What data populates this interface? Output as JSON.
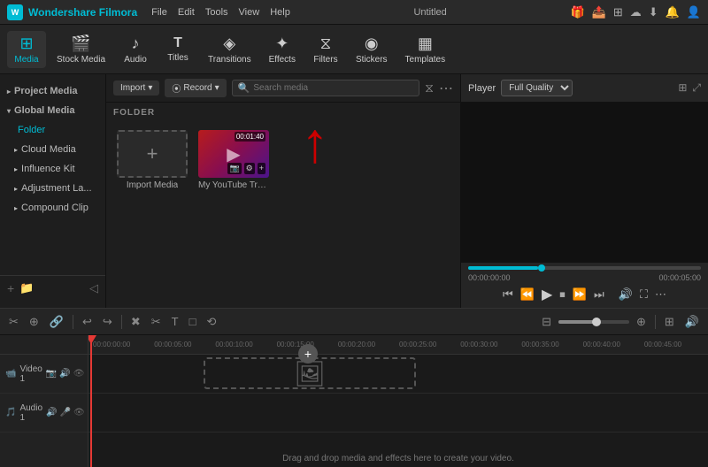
{
  "app": {
    "name": "Wondershare Filmora",
    "title": "Untitled",
    "icon": "W"
  },
  "menu": [
    "File",
    "Edit",
    "Tools",
    "View",
    "Help"
  ],
  "toolbar": {
    "items": [
      {
        "id": "media",
        "icon": "⊞",
        "label": "Media",
        "active": true
      },
      {
        "id": "stock",
        "icon": "🎬",
        "label": "Stock Media"
      },
      {
        "id": "audio",
        "icon": "♪",
        "label": "Audio"
      },
      {
        "id": "titles",
        "icon": "T",
        "label": "Titles"
      },
      {
        "id": "transitions",
        "icon": "◈",
        "label": "Transitions"
      },
      {
        "id": "effects",
        "icon": "✦",
        "label": "Effects"
      },
      {
        "id": "filters",
        "icon": "⧖",
        "label": "Filters"
      },
      {
        "id": "stickers",
        "icon": "◉",
        "label": "Stickers"
      },
      {
        "id": "templates",
        "icon": "▦",
        "label": "Templates"
      }
    ]
  },
  "sidebar": {
    "sections": [
      {
        "items": [
          {
            "label": "Project Media",
            "arrow": "▸"
          },
          {
            "label": "Global Media",
            "arrow": "▾",
            "active_header": true
          },
          {
            "label": "Folder",
            "active": true,
            "indent": true
          },
          {
            "label": "Cloud Media",
            "arrow": "▸"
          },
          {
            "label": "Influence Kit",
            "arrow": "▸"
          },
          {
            "label": "Adjustment La...",
            "arrow": "▸"
          },
          {
            "label": "Compound Clip",
            "arrow": "▸"
          }
        ]
      }
    ],
    "bottom_icons": [
      "+",
      "📁"
    ]
  },
  "content": {
    "import_label": "Import",
    "record_label": "Record",
    "search_placeholder": "Search media",
    "folder_label": "FOLDER",
    "media_items": [
      {
        "type": "import",
        "label": "Import Media",
        "icon": "+"
      },
      {
        "type": "video",
        "label": "My YouTube Tra...",
        "duration": "00:01:40",
        "has_thumb": true
      }
    ]
  },
  "player": {
    "title": "Player",
    "quality": "Full Quality",
    "time_current": "00:00:00:00",
    "time_total": "00:00:05:00",
    "controls": [
      "⏮",
      "⏪",
      "▶",
      "⏹",
      "⏩",
      "⏭"
    ]
  },
  "timeline": {
    "toolbar_buttons": [
      "✂",
      "⊕",
      "🔗",
      "↩",
      "↪",
      "✖",
      "✂",
      "T",
      "□",
      "⟲",
      "⊡",
      "⌖",
      "⊛",
      "↑",
      "⧉",
      "⊞",
      "⊟",
      "🔊",
      "⊕"
    ],
    "ruler_marks": [
      "00:00:00:00",
      "00:00:05:00",
      "00:00:10:00",
      "00:00:15:00",
      "00:00:20:00",
      "00:00:25:00",
      "00:00:30:00",
      "00:00:35:00",
      "00:00:40:00",
      "00:00:45:00"
    ],
    "tracks": [
      {
        "label": "Video 1",
        "icons": [
          "📷",
          "🔊",
          "👁"
        ]
      },
      {
        "label": "Audio 1",
        "icons": [
          "🔊",
          "🎤",
          "👁"
        ]
      }
    ],
    "drop_text": "Drag and drop media and effects here to create your video."
  }
}
